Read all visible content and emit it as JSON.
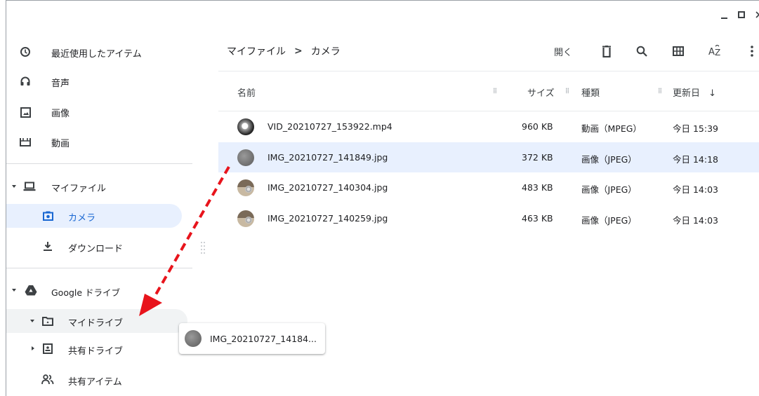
{
  "window": {
    "controls": [
      "minimize-icon",
      "maximize-icon",
      "close-icon"
    ]
  },
  "sidebar": {
    "recent_label": "最近使用したアイテム",
    "audio_label": "音声",
    "images_label": "画像",
    "videos_label": "動画",
    "my_files_label": "マイファイル",
    "camera_label": "カメラ",
    "downloads_label": "ダウンロード",
    "google_drive_label": "Google ドライブ",
    "my_drive_label": "マイドライブ",
    "shared_drives_label": "共有ドライブ",
    "shared_items_label": "共有アイテム"
  },
  "breadcrumb": {
    "root": "マイファイル",
    "separator": ">",
    "current": "カメラ"
  },
  "toolbar": {
    "open_label": "開く",
    "icons": [
      "delete-icon",
      "search-icon",
      "grid-view-icon",
      "sort-az-icon",
      "more-vert-icon"
    ]
  },
  "table": {
    "headers": {
      "name": "名前",
      "size": "サイズ",
      "type": "種類",
      "date": "更新日",
      "sort_arrow": "↓"
    },
    "rows": [
      {
        "name": "VID_20210727_153922.mp4",
        "size": "960 KB",
        "type": "動画（MPEG）",
        "date": "今日 15:39",
        "thumb": "video"
      },
      {
        "name": "IMG_20210727_141849.jpg",
        "size": "372 KB",
        "type": "画像（JPEG）",
        "date": "今日 14:18",
        "thumb": "gray",
        "selected": true
      },
      {
        "name": "IMG_20210727_140304.jpg",
        "size": "483 KB",
        "type": "画像（JPEG）",
        "date": "今日 14:03",
        "thumb": "photo"
      },
      {
        "name": "IMG_20210727_140259.jpg",
        "size": "463 KB",
        "type": "画像（JPEG）",
        "date": "今日 14:03",
        "thumb": "photo"
      }
    ]
  },
  "drag_chip": {
    "name": "IMG_20210727_14184..."
  },
  "colors": {
    "selection": "#e8f0fe",
    "selected_text": "#1967d2",
    "arrow": "#e8141c"
  }
}
